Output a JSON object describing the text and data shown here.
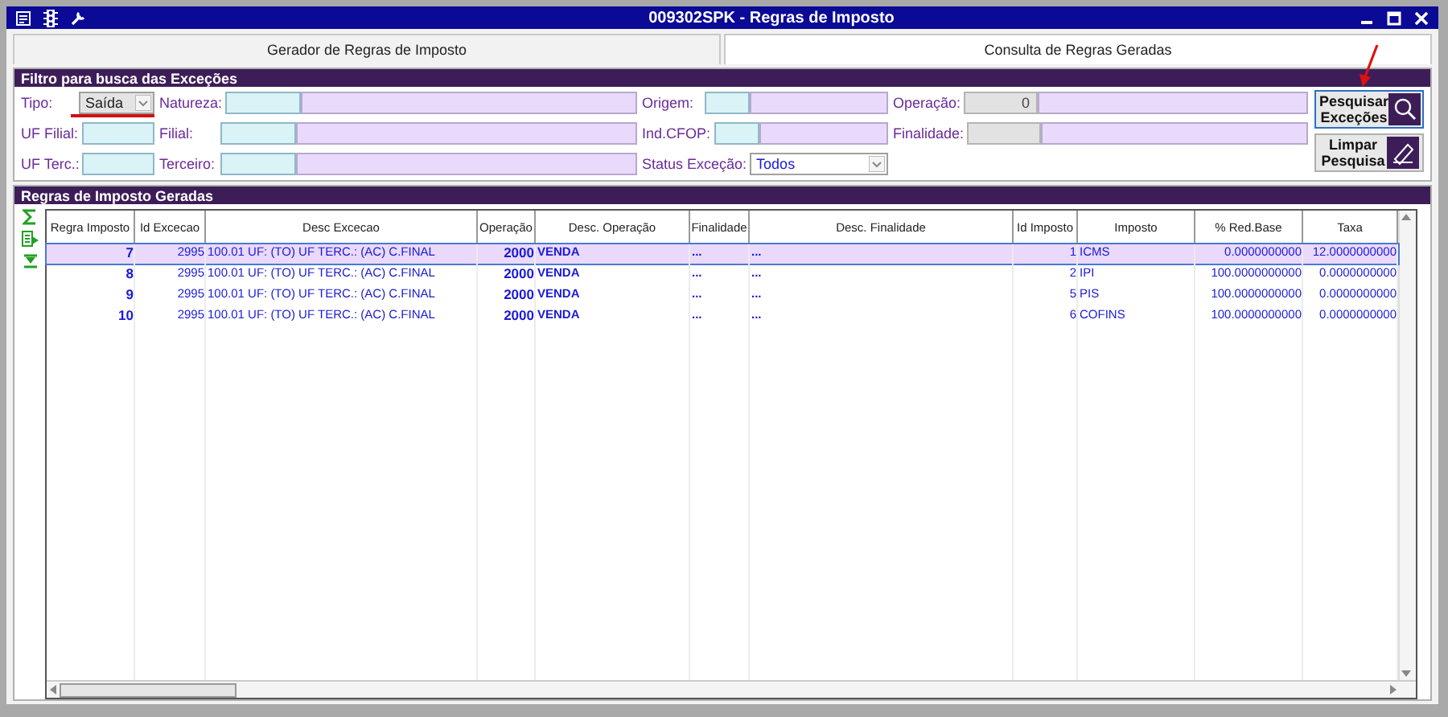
{
  "window": {
    "title": "009302SPK - Regras de Imposto"
  },
  "tabs": [
    {
      "label": "Gerador de Regras de Imposto",
      "selected": false
    },
    {
      "label": "Consulta de Regras Geradas",
      "selected": true
    }
  ],
  "filter": {
    "title": "Filtro para busca das Exceções",
    "rows": [
      [
        {
          "label": "Tipo:",
          "kind": "select",
          "value": "Saída",
          "disabled": true
        },
        {
          "label": "Natureza:",
          "kind": "lookup",
          "disabled": false
        },
        {
          "label": "Origem:",
          "kind": "lookup",
          "disabled": false
        },
        {
          "label": "Operação:",
          "kind": "lookup",
          "value": "0",
          "disabled": true
        }
      ],
      [
        {
          "label": "UF Filial:",
          "kind": "short",
          "disabled": false
        },
        {
          "label": "Filial:",
          "kind": "lookup",
          "disabled": false
        },
        {
          "label": "Ind.CFOP:",
          "kind": "lookup",
          "disabled": false
        },
        {
          "label": "Finalidade:",
          "kind": "lookup",
          "disabled": true
        }
      ],
      [
        {
          "label": "UF Terc.:",
          "kind": "short",
          "disabled": false
        },
        {
          "label": "Terceiro:",
          "kind": "lookup",
          "disabled": false
        },
        {
          "label": "Status Exceção:",
          "kind": "select",
          "value": "Todos",
          "disabled": false
        }
      ]
    ],
    "buttons": [
      {
        "label": "Pesquisar Exceções",
        "kind": "search",
        "focused": true
      },
      {
        "label": "Limpar Pesquisa",
        "kind": "clear",
        "focused": false
      }
    ]
  },
  "grid": {
    "title": "Regras de Imposto Geradas",
    "columns": [
      {
        "label": "Regra Imposto",
        "kind": "numbold"
      },
      {
        "label": "Id Excecao",
        "kind": "num"
      },
      {
        "label": "Desc Excecao",
        "kind": "text"
      },
      {
        "label": "Operação",
        "kind": "numbold"
      },
      {
        "label": "Desc. Operação",
        "kind": "textbold"
      },
      {
        "label": "Finalidade",
        "kind": "textbold"
      },
      {
        "label": "Desc. Finalidade",
        "kind": "textbold"
      },
      {
        "label": "Id Imposto",
        "kind": "num"
      },
      {
        "label": "Imposto",
        "kind": "text"
      },
      {
        "label": "% Red.Base",
        "kind": "num"
      },
      {
        "label": "Taxa",
        "kind": "num"
      }
    ],
    "rows": [
      {
        "selected": true,
        "cells": [
          "7",
          "2995",
          "100.01 UF: (TO) UF TERC.: (AC) C.FINAL",
          "2000",
          "VENDA",
          "...",
          "...",
          "1",
          "ICMS",
          "0.0000000000",
          "12.0000000000"
        ]
      },
      {
        "selected": false,
        "cells": [
          "8",
          "2995",
          "100.01 UF: (TO) UF TERC.: (AC) C.FINAL",
          "2000",
          "VENDA",
          "...",
          "...",
          "2",
          "IPI",
          "100.0000000000",
          "0.0000000000"
        ]
      },
      {
        "selected": false,
        "cells": [
          "9",
          "2995",
          "100.01 UF: (TO) UF TERC.: (AC) C.FINAL",
          "2000",
          "VENDA",
          "...",
          "...",
          "5",
          "PIS",
          "100.0000000000",
          "0.0000000000"
        ]
      },
      {
        "selected": false,
        "cells": [
          "10",
          "2995",
          "100.01 UF: (TO) UF TERC.: (AC) C.FINAL",
          "2000",
          "VENDA",
          "...",
          "...",
          "6",
          "COFINS",
          "100.0000000000",
          "0.0000000000"
        ]
      }
    ]
  }
}
